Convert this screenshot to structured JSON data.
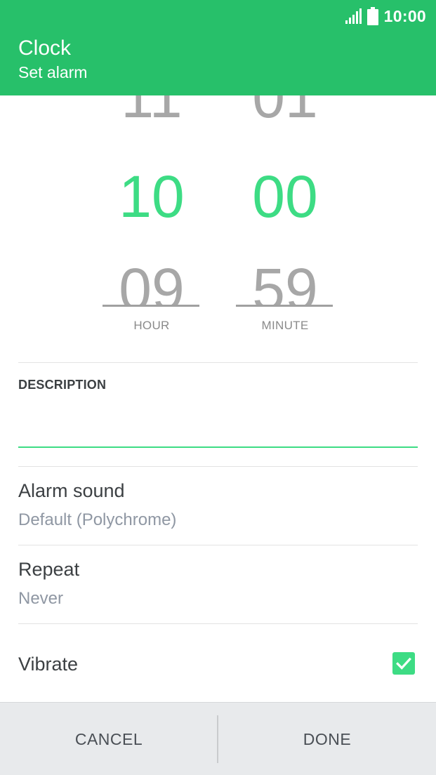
{
  "status_bar": {
    "time": "10:00",
    "signal_icon": "signal-icon",
    "battery_icon": "battery-icon"
  },
  "header": {
    "title": "Clock",
    "subtitle": "Set alarm",
    "color": "#27c06a"
  },
  "picker": {
    "hour": {
      "prev": "11",
      "current": "10",
      "next": "09",
      "label": "HOUR"
    },
    "minute": {
      "prev": "01",
      "current": "00",
      "next": "59",
      "label": "MINUTE"
    },
    "accent": "#3ddc84"
  },
  "description": {
    "label": "DESCRIPTION",
    "value": "",
    "placeholder": ""
  },
  "alarm_sound": {
    "title": "Alarm sound",
    "value": "Default (Polychrome)"
  },
  "repeat": {
    "title": "Repeat",
    "value": "Never"
  },
  "vibrate": {
    "title": "Vibrate",
    "checked": true,
    "check_icon": "check-icon"
  },
  "buttons": {
    "cancel": "CANCEL",
    "done": "DONE"
  }
}
